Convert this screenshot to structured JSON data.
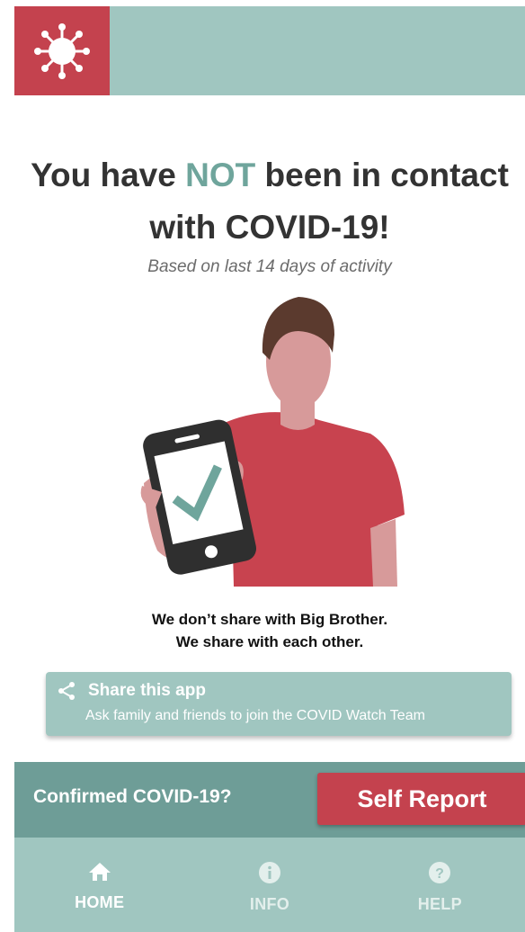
{
  "header": {
    "logo_icon": "virus-icon",
    "brand_color": "#c4424e",
    "bar_color": "#a0c6c0"
  },
  "status": {
    "headline_pre": "You have ",
    "headline_accent": "NOT",
    "headline_post": " been in contact with COVID-19!",
    "subline": "Based on last 14 days of activity"
  },
  "tagline": {
    "line1": "We don’t share with Big Brother.",
    "line2": "We share with each other."
  },
  "share": {
    "icon": "share-icon",
    "title": "Share this app",
    "subtitle": "Ask family and friends to join the COVID Watch Team"
  },
  "report": {
    "label": "Confirmed COVID-19?",
    "button_label": "Self Report"
  },
  "tabs": [
    {
      "label": "HOME",
      "icon": "home-icon",
      "active": true
    },
    {
      "label": "INFO",
      "icon": "info-icon",
      "active": false
    },
    {
      "label": "HELP",
      "icon": "help-icon",
      "active": false
    }
  ]
}
